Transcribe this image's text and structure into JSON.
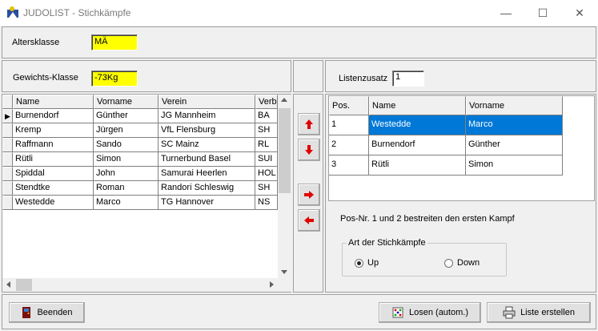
{
  "window": {
    "title": "JUDOLIST - Stichkämpfe",
    "minimize": "—",
    "maximize": "☐",
    "close": "✕"
  },
  "altersklasse": {
    "label": "Altersklasse",
    "value": "MÄ"
  },
  "gewichtsklasse": {
    "label": "Gewichts-Klasse",
    "value": "-73Kg"
  },
  "listenzusatz": {
    "label": "Listenzusatz",
    "value": "1"
  },
  "left_table": {
    "headers": [
      "Name",
      "Vorname",
      "Verein",
      "Verba"
    ],
    "rows": [
      [
        "Burnendorf",
        "Günther",
        "JG Mannheim",
        "BA"
      ],
      [
        "Kremp",
        "Jürgen",
        "VfL Flensburg",
        "SH"
      ],
      [
        "Raffmann",
        "Sando",
        "SC Mainz",
        "RL"
      ],
      [
        "Rütli",
        "Simon",
        "Turnerbund Basel",
        "SUI"
      ],
      [
        "Spiddal",
        "John",
        "Samurai Heerlen",
        "HOL"
      ],
      [
        "Stendtke",
        "Roman",
        "Randori Schleswig",
        "SH"
      ],
      [
        "Westedde",
        "Marco",
        "TG Hannover",
        "NS"
      ]
    ],
    "current_row_marker": "▶"
  },
  "right_table": {
    "headers": [
      "Pos.",
      "Name",
      "Vorname"
    ],
    "rows": [
      [
        "1",
        "Westedde",
        "Marco"
      ],
      [
        "2",
        "Burnendorf",
        "Günther"
      ],
      [
        "3",
        "Rütli",
        "Simon"
      ]
    ],
    "selected_row": 0
  },
  "info_text": "Pos-Nr. 1 und 2 bestreiten den ersten Kampf",
  "stichkampf": {
    "legend": "Art der Stichkämpfe",
    "options": [
      "Up",
      "Down"
    ],
    "selected": "Up"
  },
  "buttons": {
    "beenden": "Beenden",
    "losen": "Losen (autom.)",
    "liste": "Liste erstellen"
  },
  "colors": {
    "highlight_field": "#ffff00",
    "selection": "#0078d7",
    "arrow": "#e00000"
  }
}
